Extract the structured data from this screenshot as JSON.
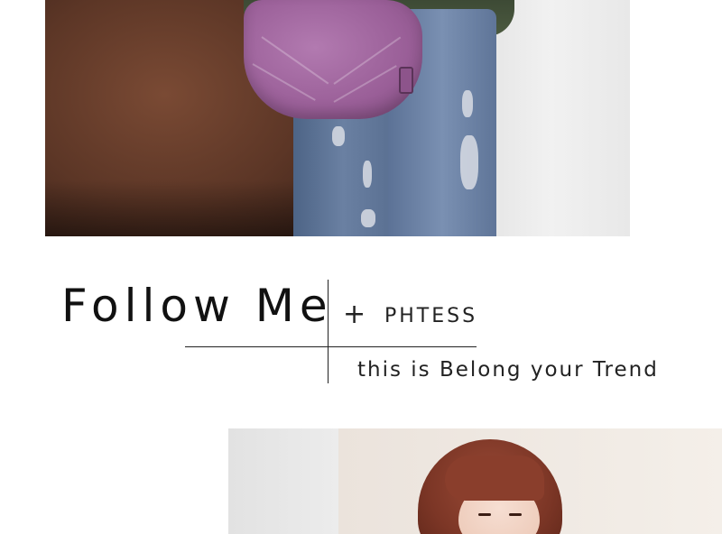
{
  "headline": {
    "title": "Follow Me",
    "plus_symbol": "+",
    "brand": "PHTESS",
    "tagline": "this is Belong your Trend"
  },
  "images": {
    "top": "photo-woman-jeans-purple-handbag",
    "bottom": "photo-woman-red-hair"
  },
  "colors": {
    "text": "#111111",
    "bag_purple": "#9a5f98",
    "denim": "#6a80a2",
    "sofa": "#5c3626"
  }
}
